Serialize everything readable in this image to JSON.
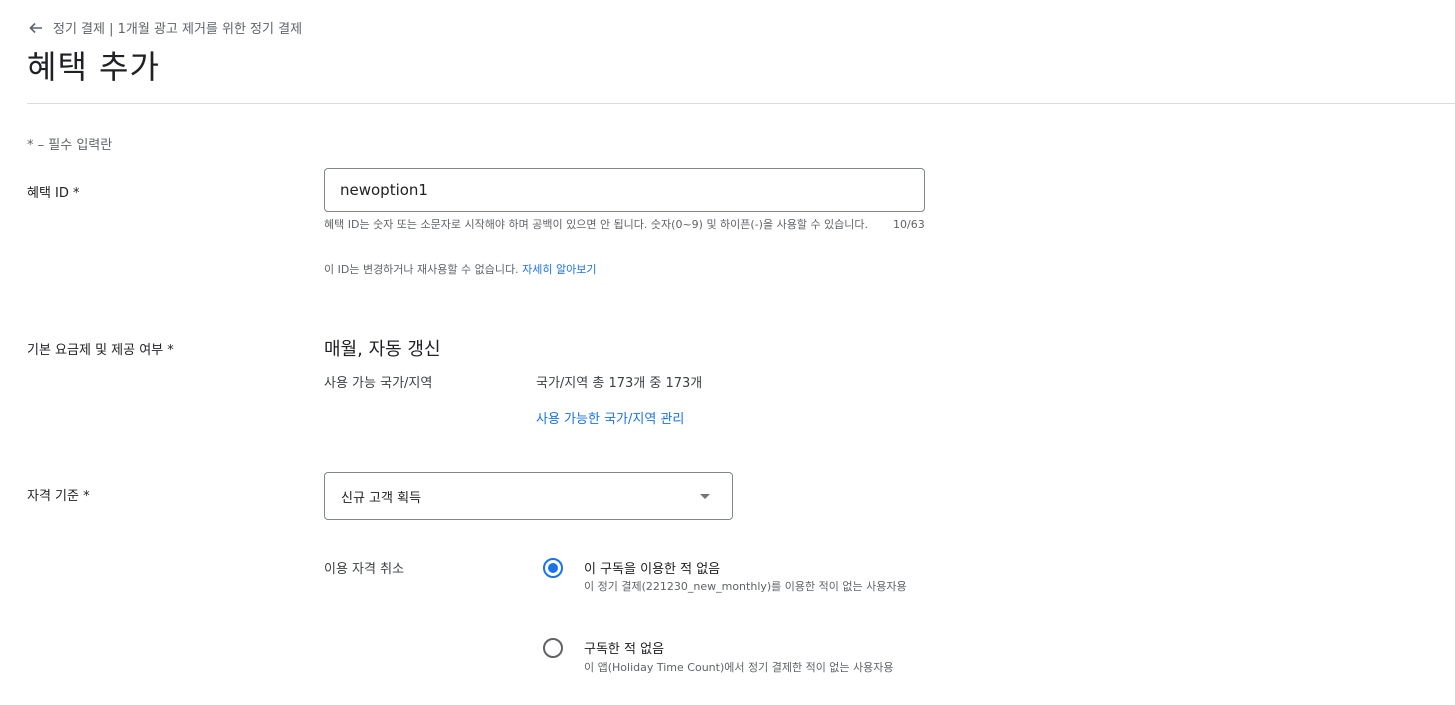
{
  "breadcrumb": {
    "text": "정기 결제 | 1개월 광고 제거를 위한 정기 결제"
  },
  "page": {
    "title": "혜택 추가"
  },
  "required_note": "* – 필수 입력란",
  "offer_id": {
    "label": "혜택 ID  *",
    "value": "newoption1",
    "helper": "혜택 ID는 숫자 또는 소문자로 시작해야 하며 공백이 있으면 안 됩니다. 숫자(0~9) 및 하이픈(-)을 사용할 수 있습니다.",
    "counter": "10/63",
    "note": "이 ID는 변경하거나 재사용할 수 없습니다. ",
    "learn_more": "자세히 알아보기"
  },
  "base_plan": {
    "label": "기본 요금제 및 제공 여부  *",
    "title": "매월, 자동 갱신",
    "availability_label": "사용 가능 국가/지역",
    "availability_value": "국가/지역 총 173개 중 173개",
    "manage_link": "사용 가능한 국가/지역 관리"
  },
  "eligibility": {
    "label": "자격 기준  *",
    "selected": "신규 고객 획득",
    "cancel_label": "이용 자격 취소",
    "options": [
      {
        "title": "이 구독을 이용한 적 없음",
        "desc": "이 정기 결제(221230_new_monthly)를 이용한 적이 없는 사용자용",
        "checked": true
      },
      {
        "title": "구독한 적 없음",
        "desc": "이 앱(Holiday Time Count)에서 정기 결제한 적이 없는 사용자용",
        "checked": false
      }
    ]
  },
  "colors": {
    "accent": "#1a73e8",
    "text": "#202124",
    "muted": "#5f6368",
    "border": "#80868b"
  }
}
